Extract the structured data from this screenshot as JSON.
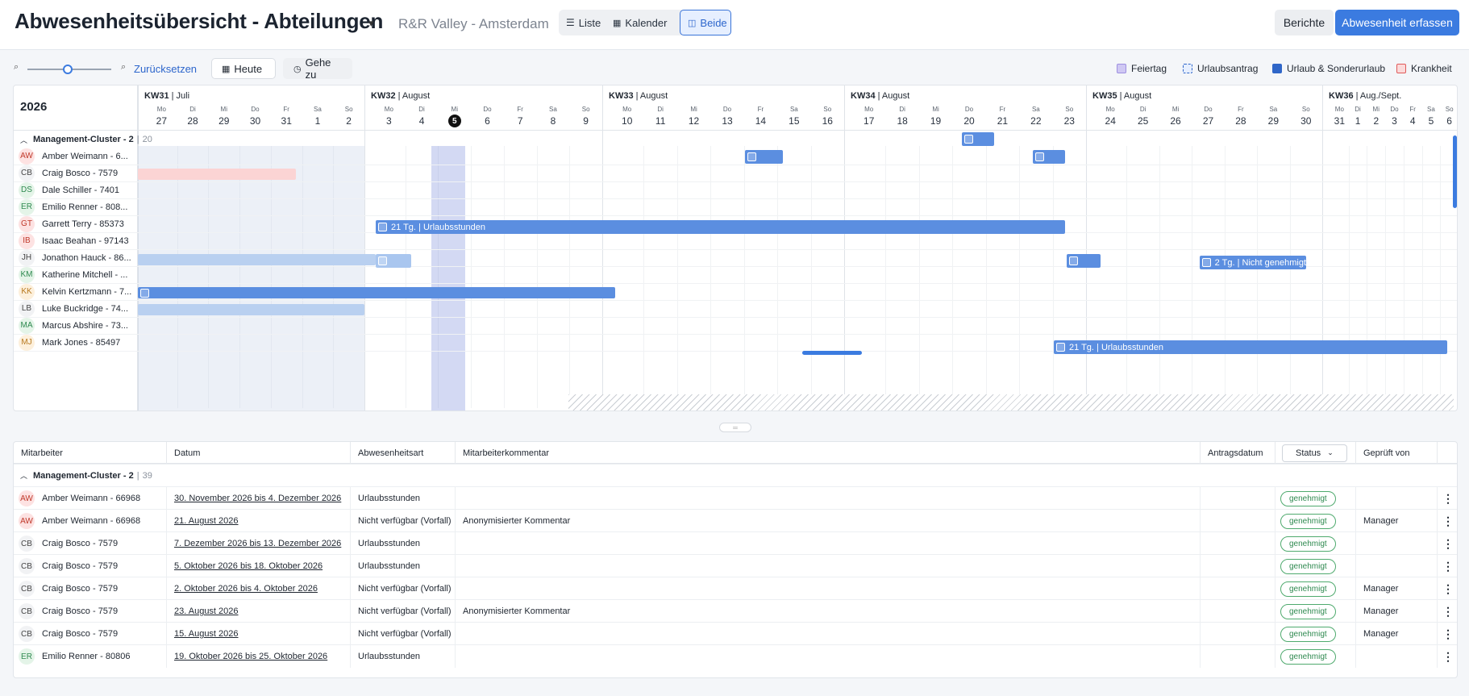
{
  "header": {
    "title": "Abwesenheitsübersicht - Abteilungen",
    "location": "R&R Valley - Amsterdam",
    "views": [
      "Liste",
      "Kalender",
      "Beide"
    ],
    "active_view": "Beide",
    "reports_label": "Berichte",
    "add_label": "Abwesenheit erfassen"
  },
  "toolbar": {
    "reset_label": "Zurücksetzen",
    "today_label": "Heute",
    "goto_label": "Gehe zu",
    "zoom_level": 0.45,
    "legend": [
      {
        "label": "Feiertag",
        "color": "#9d8fe0"
      },
      {
        "label": "Urlaubsantrag",
        "color": "#5b8ee0"
      },
      {
        "label": "Urlaub & Sonderurlaub",
        "color": "#2f66c8"
      },
      {
        "label": "Krankheit",
        "color": "#e05a5a"
      }
    ]
  },
  "calendar": {
    "year": "2026",
    "weeks": [
      {
        "kw": "KW31",
        "month": "Juli",
        "days": [
          [
            "Mo",
            "27"
          ],
          [
            "Di",
            "28"
          ],
          [
            "Mi",
            "29"
          ],
          [
            "Do",
            "30"
          ],
          [
            "Fr",
            "31"
          ],
          [
            "Sa",
            "1"
          ],
          [
            "So",
            "2"
          ]
        ]
      },
      {
        "kw": "KW32",
        "month": "August",
        "days": [
          [
            "Mo",
            "3"
          ],
          [
            "Di",
            "4"
          ],
          [
            "Mi",
            "5"
          ],
          [
            "Do",
            "6"
          ],
          [
            "Fr",
            "7"
          ],
          [
            "Sa",
            "8"
          ],
          [
            "So",
            "9"
          ]
        ]
      },
      {
        "kw": "KW33",
        "month": "August",
        "days": [
          [
            "Mo",
            "10"
          ],
          [
            "Di",
            "11"
          ],
          [
            "Mi",
            "12"
          ],
          [
            "Do",
            "13"
          ],
          [
            "Fr",
            "14"
          ],
          [
            "Sa",
            "15"
          ],
          [
            "So",
            "16"
          ]
        ]
      },
      {
        "kw": "KW34",
        "month": "August",
        "days": [
          [
            "Mo",
            "17"
          ],
          [
            "Di",
            "18"
          ],
          [
            "Mi",
            "19"
          ],
          [
            "Do",
            "20"
          ],
          [
            "Fr",
            "21"
          ],
          [
            "Sa",
            "22"
          ],
          [
            "So",
            "23"
          ]
        ]
      },
      {
        "kw": "KW35",
        "month": "August",
        "days": [
          [
            "Mo",
            "24"
          ],
          [
            "Di",
            "25"
          ],
          [
            "Mi",
            "26"
          ],
          [
            "Do",
            "27"
          ],
          [
            "Fr",
            "28"
          ],
          [
            "Sa",
            "29"
          ],
          [
            "So",
            "30"
          ]
        ]
      },
      {
        "kw": "KW36",
        "month": "Aug./Sept.",
        "days": [
          [
            "Mo",
            "31"
          ],
          [
            "Di",
            "1"
          ],
          [
            "Mi",
            "2"
          ],
          [
            "Do",
            "3"
          ],
          [
            "Fr",
            "4"
          ],
          [
            "Sa",
            "5"
          ],
          [
            "So",
            "6"
          ]
        ]
      }
    ],
    "today": "5",
    "group": {
      "name": "Management-Cluster - 2",
      "count": "20"
    },
    "employees": [
      {
        "initials": "AW",
        "name": "Amber Weimann - 6...",
        "av_bg": "#fde2e2",
        "av_fg": "#c0392b"
      },
      {
        "initials": "CB",
        "name": "Craig Bosco - 7579",
        "av_bg": "#f1f2f4",
        "av_fg": "#444"
      },
      {
        "initials": "DS",
        "name": "Dale Schiller - 7401",
        "av_bg": "#e4f4e8",
        "av_fg": "#2f8a50"
      },
      {
        "initials": "ER",
        "name": "Emilio Renner - 808...",
        "av_bg": "#e4f4e8",
        "av_fg": "#2f8a50"
      },
      {
        "initials": "GT",
        "name": "Garrett Terry - 85373",
        "av_bg": "#fde2e2",
        "av_fg": "#c0392b"
      },
      {
        "initials": "IB",
        "name": "Isaac Beahan - 97143",
        "av_bg": "#fde2e2",
        "av_fg": "#c0392b"
      },
      {
        "initials": "JH",
        "name": "Jonathon Hauck - 86...",
        "av_bg": "#f1f2f4",
        "av_fg": "#444"
      },
      {
        "initials": "KM",
        "name": "Katherine Mitchell - ...",
        "av_bg": "#e4f4e8",
        "av_fg": "#2f8a50"
      },
      {
        "initials": "KK",
        "name": "Kelvin Kertzmann - 7...",
        "av_bg": "#fdf0dc",
        "av_fg": "#b7791f"
      },
      {
        "initials": "LB",
        "name": "Luke Buckridge - 74...",
        "av_bg": "#f1f2f4",
        "av_fg": "#444"
      },
      {
        "initials": "MA",
        "name": "Marcus Abshire - 73...",
        "av_bg": "#e4f4e8",
        "av_fg": "#2f8a50"
      },
      {
        "initials": "MJ",
        "name": "Mark Jones - 85497",
        "av_bg": "#fdf0dc",
        "av_fg": "#b7791f"
      }
    ],
    "bar_labels": {
      "garrett": "21 Tg. | Urlaubsstunden",
      "jonathon": "2 Tg. | Nicht genehmigt",
      "mark": "21 Tg. | Urlaubsstunden"
    }
  },
  "table": {
    "columns": [
      "Mitarbeiter",
      "Datum",
      "Abwesenheitsart",
      "Mitarbeiterkommentar",
      "Antragsdatum",
      "Status",
      "Geprüft von"
    ],
    "group": {
      "name": "Management-Cluster - 2",
      "count": "39"
    },
    "rows": [
      {
        "initials": "AW",
        "employee": "Amber Weimann - 66968",
        "date": "30. November 2026 bis 4. Dezember 2026",
        "type": "Urlaubsstunden",
        "comment": "",
        "status": "genehmigt",
        "reviewer": ""
      },
      {
        "initials": "AW",
        "employee": "Amber Weimann - 66968",
        "date": "21. August 2026",
        "type": "Nicht verfügbar (Vorfall)",
        "comment": "Anonymisierter Kommentar",
        "status": "genehmigt",
        "reviewer": "Manager"
      },
      {
        "initials": "CB",
        "employee": "Craig Bosco - 7579",
        "date": "7. Dezember 2026 bis 13. Dezember 2026",
        "type": "Urlaubsstunden",
        "comment": "",
        "status": "genehmigt",
        "reviewer": ""
      },
      {
        "initials": "CB",
        "employee": "Craig Bosco - 7579",
        "date": "5. Oktober 2026 bis 18. Oktober 2026",
        "type": "Urlaubsstunden",
        "comment": "",
        "status": "genehmigt",
        "reviewer": ""
      },
      {
        "initials": "CB",
        "employee": "Craig Bosco - 7579",
        "date": "2. Oktober 2026 bis 4. Oktober 2026",
        "type": "Nicht verfügbar (Vorfall)",
        "comment": "",
        "status": "genehmigt",
        "reviewer": "Manager"
      },
      {
        "initials": "CB",
        "employee": "Craig Bosco - 7579",
        "date": "23. August 2026",
        "type": "Nicht verfügbar (Vorfall)",
        "comment": "Anonymisierter Kommentar",
        "status": "genehmigt",
        "reviewer": "Manager"
      },
      {
        "initials": "CB",
        "employee": "Craig Bosco - 7579",
        "date": "15. August 2026",
        "type": "Nicht verfügbar (Vorfall)",
        "comment": "",
        "status": "genehmigt",
        "reviewer": "Manager"
      },
      {
        "initials": "ER",
        "employee": "Emilio Renner - 80806",
        "date": "19. Oktober 2026 bis 25. Oktober 2026",
        "type": "Urlaubsstunden",
        "comment": "",
        "status": "genehmigt",
        "reviewer": ""
      }
    ]
  }
}
